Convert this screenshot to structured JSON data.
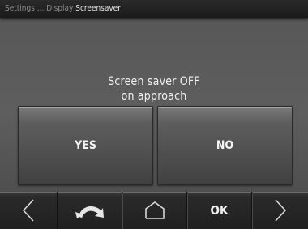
{
  "breadcrumb": {
    "parent_1": "Settings",
    "separator": "...",
    "parent_2": "Display",
    "current": "Screensaver"
  },
  "dialog": {
    "line_1": "Screen saver OFF",
    "line_2": "on approach",
    "yes_label": "YES",
    "no_label": "NO"
  },
  "navbar": {
    "items": [
      {
        "icon": "arrow-left-icon"
      },
      {
        "icon": "back-arrow-icon"
      },
      {
        "icon": "home-icon"
      },
      {
        "label": "OK"
      },
      {
        "icon": "arrow-right-icon"
      }
    ]
  },
  "colors": {
    "background": "#5a5a5a",
    "titlebar": "#1a1a1a",
    "button": "#4b4b4b",
    "text": "#f2f2f2"
  }
}
